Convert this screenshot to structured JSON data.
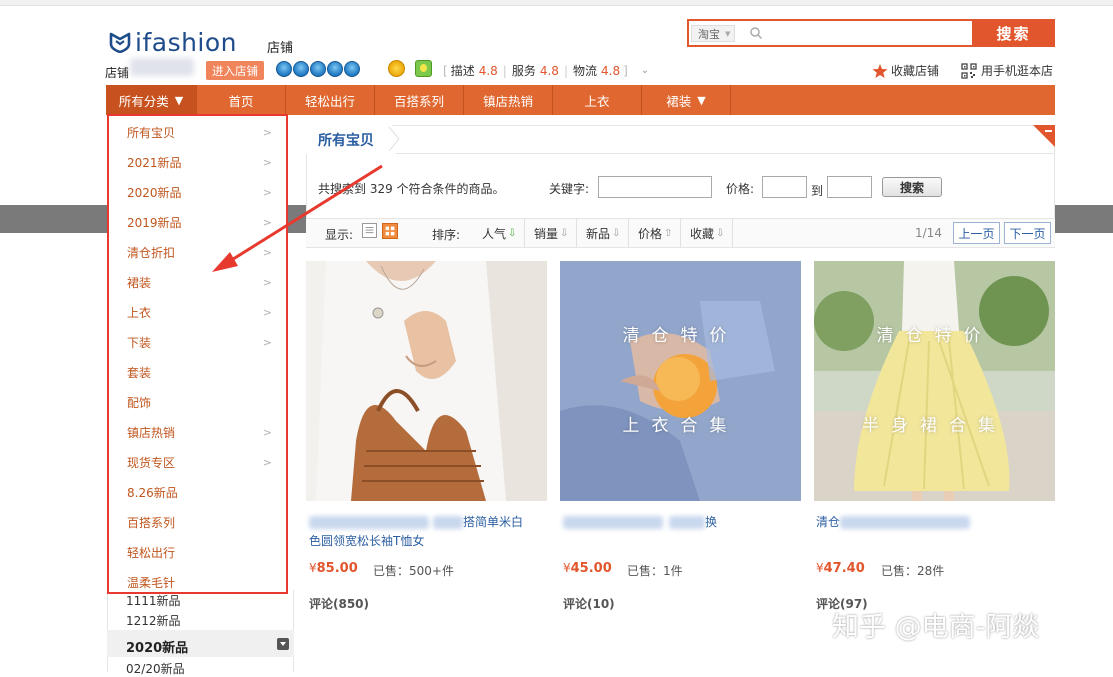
{
  "header": {
    "brand": "ifashion",
    "shop_word": "店铺",
    "search": {
      "scope": "淘宝",
      "placeholder": "",
      "button_label": "搜索"
    },
    "shop_label": "店铺",
    "enter_shop_label": "进入店铺",
    "ratings": [
      {
        "label": "描述",
        "score": "4.8"
      },
      {
        "label": "服务",
        "score": "4.8"
      },
      {
        "label": "物流",
        "score": "4.8"
      }
    ],
    "fav_shop_label": "收藏店铺",
    "mobile_shop_label": "用手机逛本店",
    "accent_color": "#e2562d",
    "icons": [
      "shield-logo-icon",
      "search-icon",
      "crown-icon",
      "medal-icon",
      "badge-icon",
      "star-icon",
      "qr-code-icon"
    ]
  },
  "nav": {
    "all_label": "所有分类",
    "items": [
      "首页",
      "轻松出行",
      "百搭系列",
      "镇店热销",
      "上衣",
      "裙装"
    ],
    "bar_color": "#e06830"
  },
  "dropdown": {
    "items": [
      {
        "label": "所有宝贝",
        "chevron": ">"
      },
      {
        "label": "2021新品",
        "chevron": ">"
      },
      {
        "label": "2020新品",
        "chevron": ">"
      },
      {
        "label": "2019新品",
        "chevron": ">"
      },
      {
        "label": "清仓折扣",
        "chevron": ">"
      },
      {
        "label": "裙装",
        "chevron": ">"
      },
      {
        "label": "上衣",
        "chevron": ">"
      },
      {
        "label": "下装",
        "chevron": ">"
      },
      {
        "label": "套装",
        "chevron": ""
      },
      {
        "label": "配饰",
        "chevron": ""
      },
      {
        "label": "镇店热销",
        "chevron": ">"
      },
      {
        "label": "现货专区",
        "chevron": ">"
      },
      {
        "label": "8.26新品",
        "chevron": ""
      },
      {
        "label": "百搭系列",
        "chevron": ""
      },
      {
        "label": "轻松出行",
        "chevron": ""
      },
      {
        "label": "温柔毛针",
        "chevron": ""
      }
    ]
  },
  "sidebar_bg": {
    "items": [
      "1111新品",
      "1212新品"
    ],
    "section_title": "2020新品",
    "sub_item": "02/20新品"
  },
  "main": {
    "tab_label": "所有宝贝",
    "result_text": "共搜索到 329 个符合条件的商品。",
    "keyword_label": "关键字:",
    "price_label": "价格:",
    "to_label": "到",
    "search_go_label": "搜索",
    "show_label": "显示:",
    "sort_label": "排序:",
    "sort_items": [
      {
        "label": "人气",
        "arrow": "⇩",
        "active": true
      },
      {
        "label": "销量",
        "arrow": "⇩"
      },
      {
        "label": "新品",
        "arrow": "⇩"
      },
      {
        "label": "价格",
        "arrow": "⇧"
      },
      {
        "label": "收藏",
        "arrow": "⇩"
      }
    ],
    "page_indicator": "1/14",
    "prev_label": "上一页",
    "next_label": "下一页"
  },
  "products": [
    {
      "title_visible_1": "搭简单米白",
      "title_visible_2": "色圆领宽松长袖T恤女",
      "overlay_top": "",
      "overlay_bottom": "",
      "price_symbol": "¥",
      "price": "85.00",
      "sold": "已售：500+件",
      "reviews": "评论(850)"
    },
    {
      "title_visible_1": "换",
      "title_visible_2": "",
      "overlay_top": "清仓特价",
      "overlay_bottom": "上衣合集",
      "price_symbol": "¥",
      "price": "45.00",
      "sold": "已售：1件",
      "reviews": "评论(10)"
    },
    {
      "title_visible_1": "清仓",
      "title_visible_2": "",
      "overlay_top": "清仓特价",
      "overlay_bottom": "半身裙合集",
      "price_symbol": "¥",
      "price": "47.40",
      "sold": "已售：28件",
      "reviews": "评论(97)"
    }
  ],
  "watermark": "知乎 @电商-阿燚"
}
